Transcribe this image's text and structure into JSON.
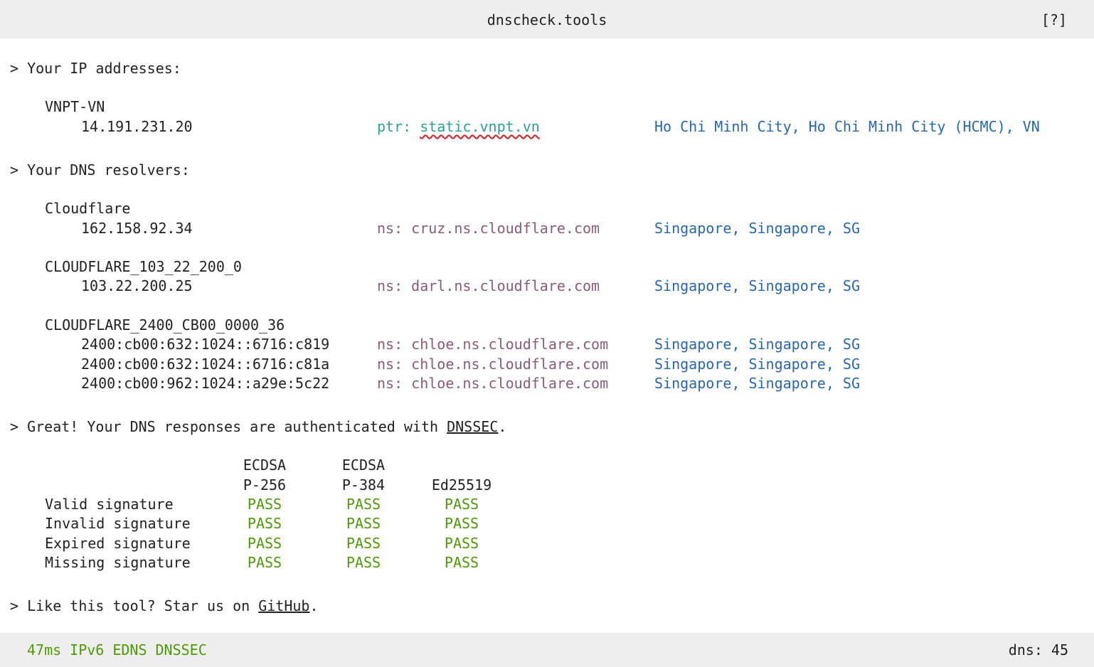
{
  "header": {
    "title": "dnscheck.tools",
    "help": "[?]"
  },
  "ip_section": {
    "heading": "> Your IP addresses:",
    "groups": [
      {
        "name": "VNPT-VN",
        "entries": [
          {
            "ip": "14.191.231.20",
            "ptr_label": "ptr: ",
            "ptr_host": "static.vnpt.vn",
            "location": "Ho Chi Minh City, Ho Chi Minh City (HCMC), VN"
          }
        ]
      }
    ]
  },
  "dns_section": {
    "heading": "> Your DNS resolvers:",
    "groups": [
      {
        "name": "Cloudflare",
        "entries": [
          {
            "ip": "162.158.92.34",
            "ns": "ns: cruz.ns.cloudflare.com",
            "location": "Singapore, Singapore, SG"
          }
        ]
      },
      {
        "name": "CLOUDFLARE_103_22_200_0",
        "entries": [
          {
            "ip": "103.22.200.25",
            "ns": "ns: darl.ns.cloudflare.com",
            "location": "Singapore, Singapore, SG"
          }
        ]
      },
      {
        "name": "CLOUDFLARE_2400_CB00_0000_36",
        "entries": [
          {
            "ip": "2400:cb00:632:1024::6716:c819",
            "ns": "ns: chloe.ns.cloudflare.com",
            "location": "Singapore, Singapore, SG"
          },
          {
            "ip": "2400:cb00:632:1024::6716:c81a",
            "ns": "ns: chloe.ns.cloudflare.com",
            "location": "Singapore, Singapore, SG"
          },
          {
            "ip": "2400:cb00:962:1024::a29e:5c22",
            "ns": "ns: chloe.ns.cloudflare.com",
            "location": "Singapore, Singapore, SG"
          }
        ]
      }
    ]
  },
  "dnssec_section": {
    "heading_prefix": "> Great! Your DNS responses are authenticated with ",
    "heading_link": "DNSSEC",
    "heading_suffix": ".",
    "columns": [
      {
        "line1": "ECDSA",
        "line2": "P-256"
      },
      {
        "line1": "ECDSA",
        "line2": "P-384"
      },
      {
        "line1": "",
        "line2": "Ed25519"
      }
    ],
    "rows": [
      {
        "label": "Valid signature",
        "results": [
          "PASS",
          "PASS",
          "PASS"
        ]
      },
      {
        "label": "Invalid signature",
        "results": [
          "PASS",
          "PASS",
          "PASS"
        ]
      },
      {
        "label": "Expired signature",
        "results": [
          "PASS",
          "PASS",
          "PASS"
        ]
      },
      {
        "label": "Missing signature",
        "results": [
          "PASS",
          "PASS",
          "PASS"
        ]
      }
    ]
  },
  "github_section": {
    "prefix": "> Like this tool? Star us on ",
    "link": "GitHub",
    "suffix": "."
  },
  "footer": {
    "flags": [
      "47ms",
      "IPv6",
      "EDNS",
      "DNSSEC"
    ],
    "dns_count": "dns: 45"
  },
  "colors": {
    "ptr": "#2aa198",
    "ns": "#8a5a7a",
    "location": "#2767b0",
    "pass": "#4e9a06"
  }
}
